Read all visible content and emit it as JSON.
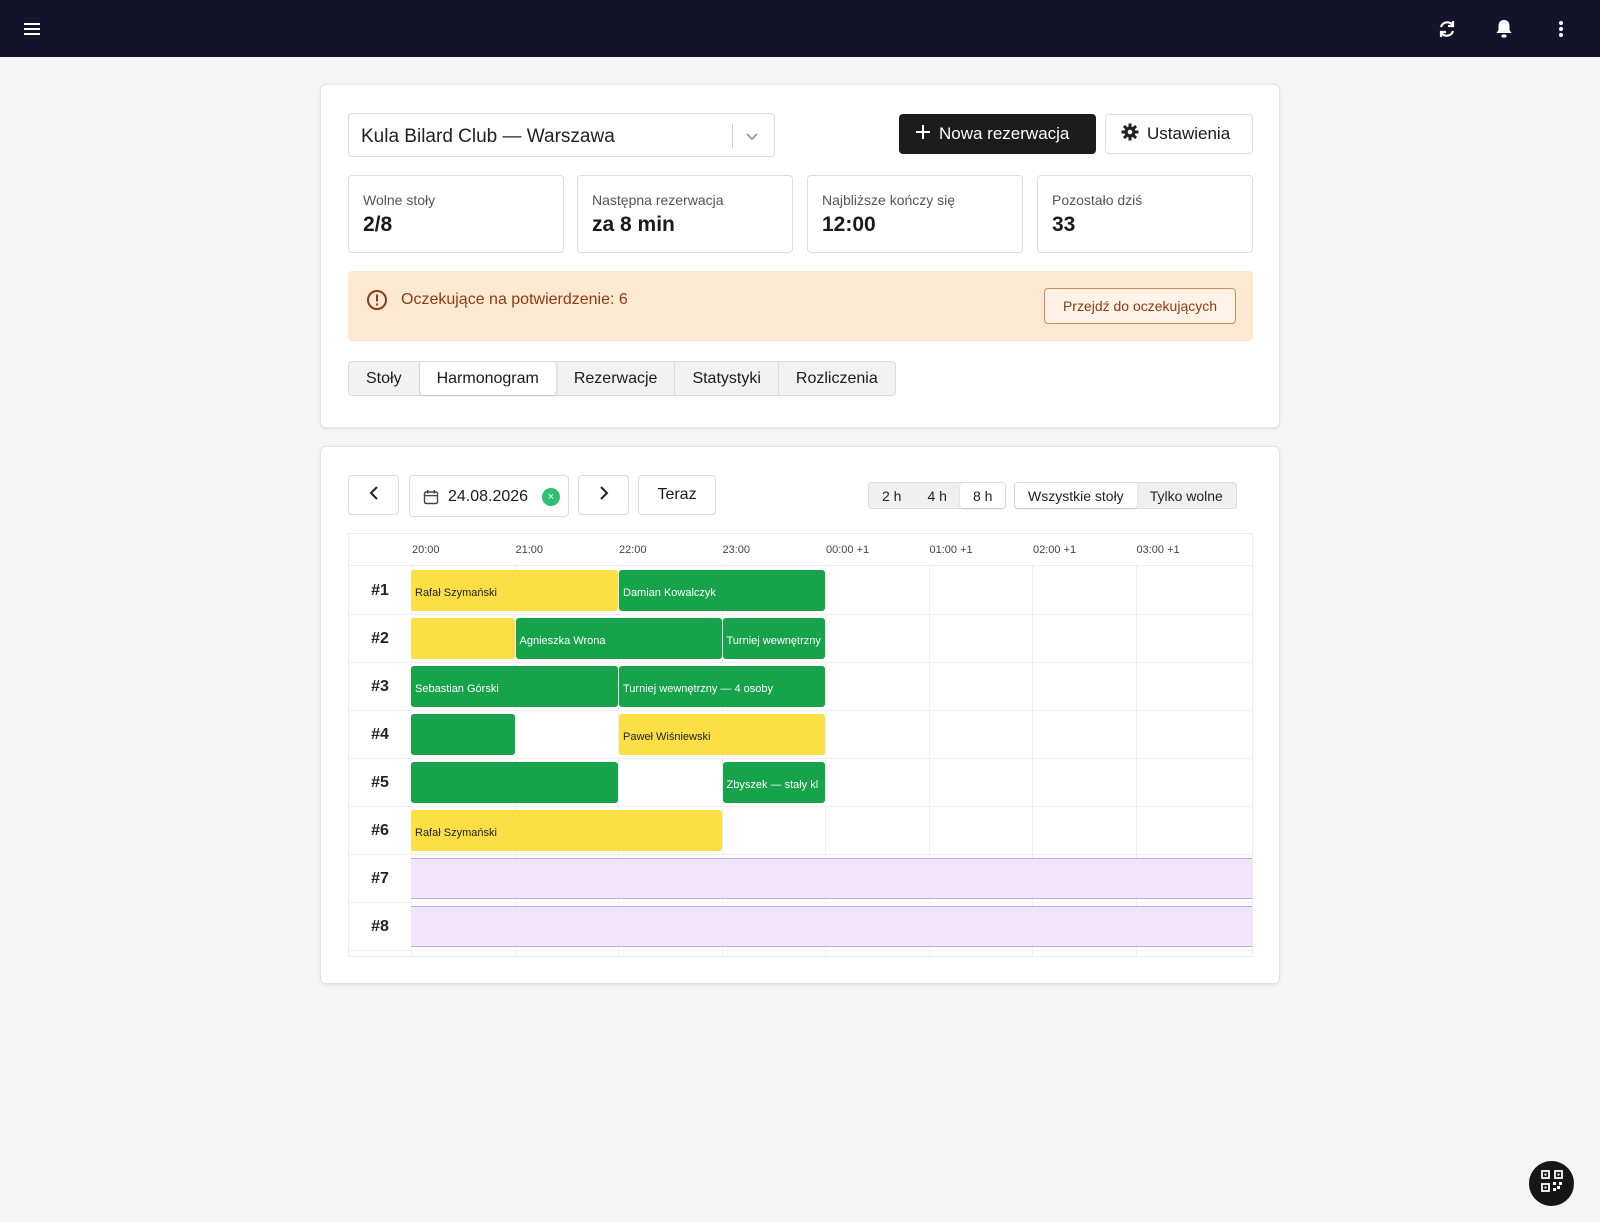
{
  "topbar": {
    "menu_icon": "hamburger-icon",
    "refresh_icon": "refresh-icon",
    "bell_icon": "bell-icon",
    "more_icon": "more-vertical-icon"
  },
  "header": {
    "club": "Kula Bilard Club — Warszawa",
    "new_button": "Nowa rezerwacja",
    "settings_button": "Ustawienia"
  },
  "stats": [
    {
      "label": "Wolne stoły",
      "value": "2/8"
    },
    {
      "label": "Następna rezerwacja",
      "value": "za 8 min"
    },
    {
      "label": "Najbliższe kończy się",
      "value": "12:00"
    },
    {
      "label": "Pozostało dziś",
      "value": "33"
    }
  ],
  "alert": {
    "text": "Oczekujące na potwierdzenie: 6",
    "button": "Przejdź do oczekujących"
  },
  "tabs": [
    {
      "label": "Stoły",
      "active": false
    },
    {
      "label": "Harmonogram",
      "active": true
    },
    {
      "label": "Rezerwacje",
      "active": false
    },
    {
      "label": "Statystyki",
      "active": false
    },
    {
      "label": "Rozliczenia",
      "active": false
    }
  ],
  "schedule": {
    "date": "24.08.2026",
    "clear_glyph": "×",
    "now_button": "Teraz",
    "ranges": [
      {
        "label": "2 h",
        "active": false
      },
      {
        "label": "4 h",
        "active": false
      },
      {
        "label": "8 h",
        "active": true
      }
    ],
    "filters": [
      {
        "label": "Wszystkie stoły",
        "active": true
      },
      {
        "label": "Tylko wolne",
        "active": false
      }
    ],
    "hours": [
      "20:00",
      "21:00",
      "22:00",
      "23:00",
      "00:00 +1",
      "01:00 +1",
      "02:00 +1",
      "03:00 +1"
    ],
    "tables": [
      {
        "label": "#1",
        "blocked": false,
        "bookings": [
          {
            "start": 0,
            "end": 2,
            "name": "Rafał Szymański",
            "color": "yellow"
          },
          {
            "start": 2,
            "end": 4,
            "name": "Damian Kowalczyk",
            "color": "green"
          }
        ]
      },
      {
        "label": "#2",
        "blocked": false,
        "bookings": [
          {
            "start": 0,
            "end": 1,
            "name": "",
            "color": "yellow"
          },
          {
            "start": 1,
            "end": 3,
            "name": "Agnieszka Wrona",
            "color": "green"
          },
          {
            "start": 3,
            "end": 4,
            "name": "Turniej wewnętrzny",
            "color": "green"
          }
        ]
      },
      {
        "label": "#3",
        "blocked": false,
        "bookings": [
          {
            "start": 0,
            "end": 2,
            "name": "Sebastian Górski",
            "color": "green"
          },
          {
            "start": 2,
            "end": 4,
            "name": "Turniej wewnętrzny — 4 osoby",
            "color": "green"
          }
        ]
      },
      {
        "label": "#4",
        "blocked": false,
        "bookings": [
          {
            "start": 0,
            "end": 1,
            "name": "",
            "color": "green"
          },
          {
            "start": 2,
            "end": 4,
            "name": "Paweł Wiśniewski",
            "color": "yellow"
          }
        ]
      },
      {
        "label": "#5",
        "blocked": false,
        "bookings": [
          {
            "start": 0,
            "end": 2,
            "name": "",
            "color": "green"
          },
          {
            "start": 3,
            "end": 4,
            "name": "Zbyszek — stały kl",
            "color": "green"
          }
        ]
      },
      {
        "label": "#6",
        "blocked": false,
        "bookings": [
          {
            "start": 0,
            "end": 3,
            "name": "Rafał Szymański",
            "color": "yellow"
          }
        ]
      },
      {
        "label": "#7",
        "blocked": true,
        "bookings": []
      },
      {
        "label": "#8",
        "blocked": true,
        "bookings": []
      }
    ]
  },
  "colors": {
    "topbar": "#13132b",
    "green": "#16a34a",
    "yellow": "#fcdf45",
    "blocked": "#f1e4fb",
    "alert_bg": "#fde8d2"
  },
  "fab_icon": "qr-code-icon"
}
